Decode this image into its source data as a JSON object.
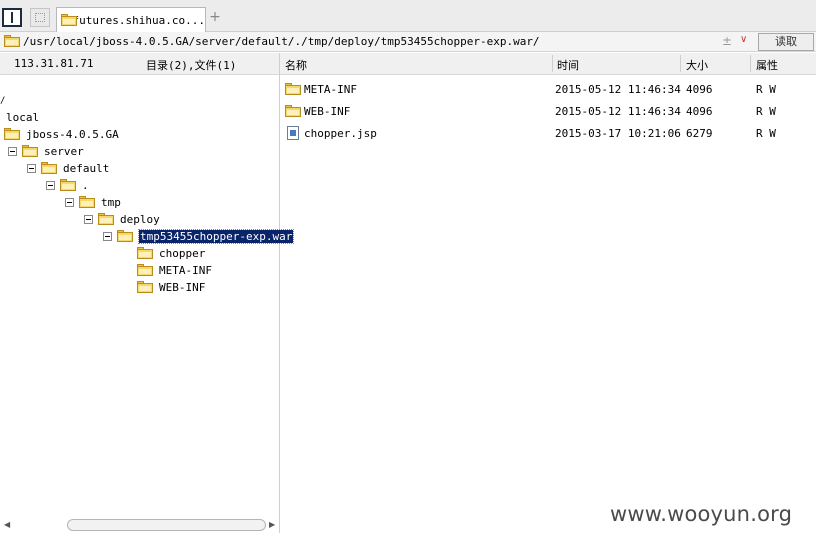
{
  "tabs": {
    "active_label": "futures.shihua.co...",
    "new_tab_symbol": "+"
  },
  "address": {
    "path": "/usr/local/jboss-4.0.5.GA/server/default/./tmp/deploy/tmp53455chopper-exp.war/",
    "plus_symbol": "±",
    "dropdown_symbol": "∨",
    "read_button": "读取"
  },
  "left_header": {
    "ip": "113.31.81.71",
    "counts": "目录(2),文件(1)"
  },
  "columns": {
    "name": "名称",
    "time": "时间",
    "size": "大小",
    "attr": "属性"
  },
  "tree": {
    "root_mark": "/",
    "items": [
      {
        "label": "local"
      },
      {
        "label": "jboss-4.0.5.GA"
      },
      {
        "label": "server"
      },
      {
        "label": "default"
      },
      {
        "label": "."
      },
      {
        "label": "tmp"
      },
      {
        "label": "deploy"
      },
      {
        "label": "tmp53455chopper-exp.war"
      },
      {
        "label": "chopper"
      },
      {
        "label": "META-INF"
      },
      {
        "label": "WEB-INF"
      }
    ]
  },
  "files": [
    {
      "name": "META-INF",
      "type": "folder",
      "time": "2015-05-12 11:46:34",
      "size": "4096",
      "attr": "R W"
    },
    {
      "name": "WEB-INF",
      "type": "folder",
      "time": "2015-05-12 11:46:34",
      "size": "4096",
      "attr": "R W"
    },
    {
      "name": "chopper.jsp",
      "type": "file",
      "time": "2015-03-17 10:21:06",
      "size": "6279",
      "attr": "R W"
    }
  ],
  "scrollbar": {
    "left_arrow": "◀",
    "right_arrow": "▶"
  },
  "watermark": "www.wooyun.org",
  "colors": {
    "selection": "#0a246a",
    "folder": "#f6d86a",
    "accent_red": "#c23a3a"
  }
}
